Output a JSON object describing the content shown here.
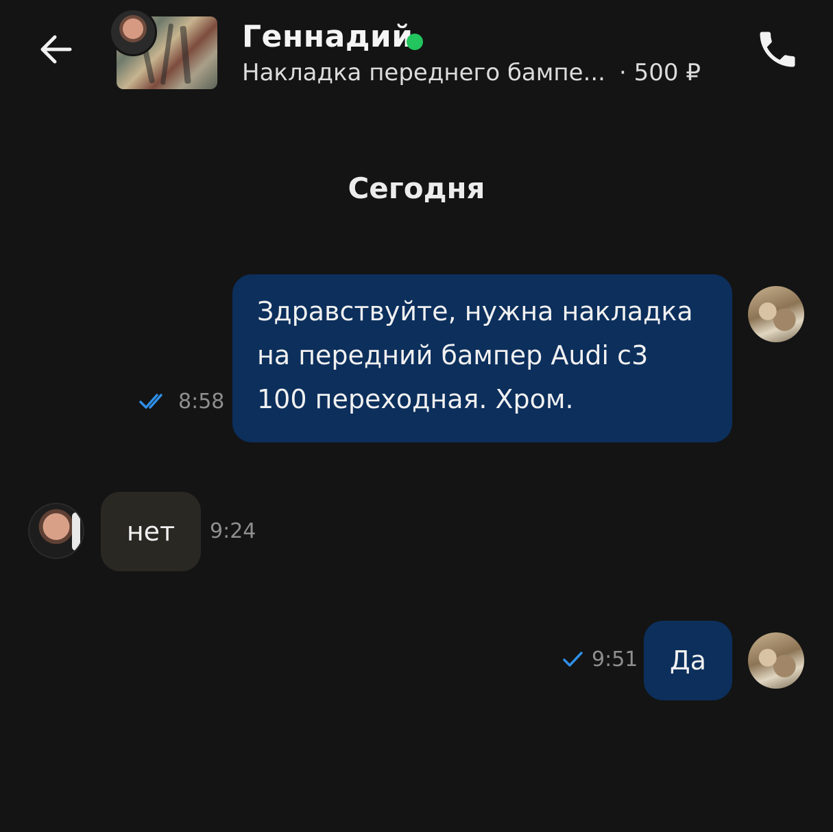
{
  "header": {
    "seller_name": "Геннадий",
    "online": true,
    "listing_title": "Накладка переднего бампе...",
    "listing_price": "· 500 ₽"
  },
  "chat": {
    "date_separator": "Сегодня",
    "messages": [
      {
        "direction": "outgoing",
        "lines": [
          "Здравствуйте, нужна накладка",
          "на передний бампер Audi c3",
          "100 переходная. Хром."
        ],
        "time": "8:58",
        "status": "read"
      },
      {
        "direction": "incoming",
        "text": "нет",
        "time": "9:24"
      },
      {
        "direction": "outgoing",
        "text": "Да",
        "time": "9:51",
        "status": "sent"
      }
    ]
  },
  "colors": {
    "background": "#141414",
    "outgoing_bubble": "#0c2f5c",
    "incoming_bubble": "#2a2823",
    "online_dot": "#22c55e",
    "check_mark": "#2f8fe8"
  },
  "icons": {
    "back": "arrow-left-icon",
    "call": "phone-icon",
    "read_status": "double-check-icon",
    "sent_status": "check-icon"
  }
}
